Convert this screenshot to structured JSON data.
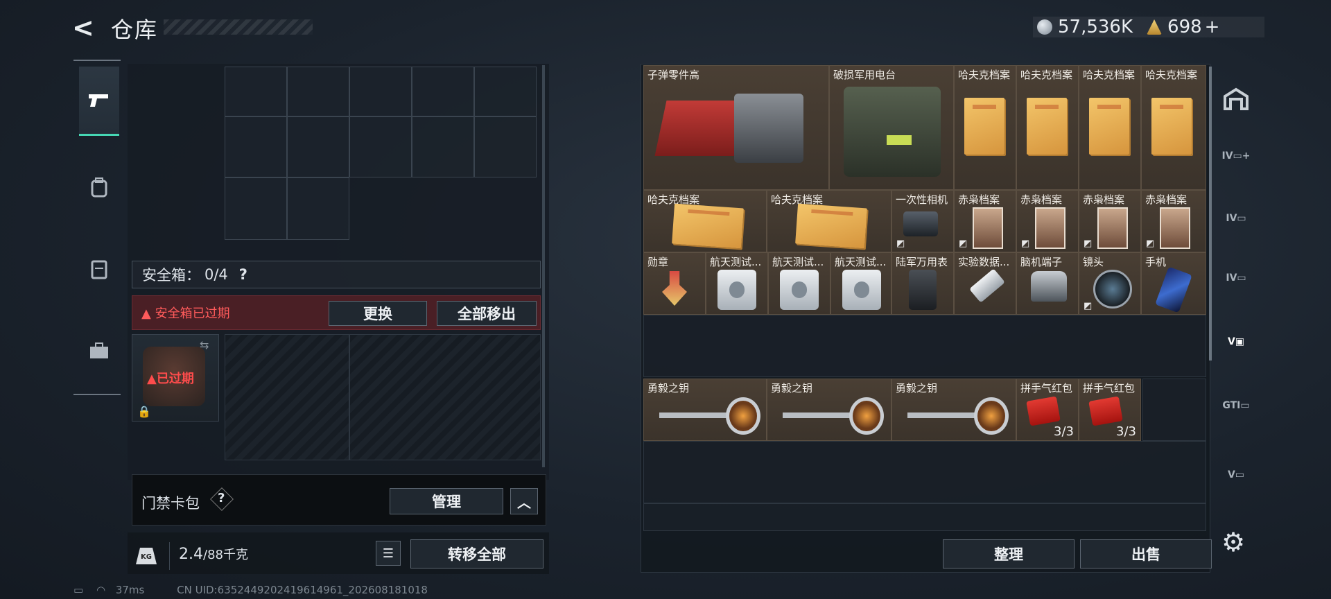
{
  "header": {
    "title": "仓库",
    "currency_silver": "57,536K",
    "currency_gold": "698",
    "add_symbol": "+"
  },
  "left_sidebar": {
    "items": [
      {
        "name": "weapon",
        "icon": "pistol-icon"
      },
      {
        "name": "backpack",
        "icon": "backpack-icon"
      },
      {
        "name": "vest",
        "icon": "vest-icon"
      },
      {
        "name": "case",
        "icon": "toolbox-icon"
      }
    ]
  },
  "safe_box": {
    "label": "安全箱：",
    "count": "0/4",
    "help": "?",
    "expired_notice": "安全箱已过期",
    "replace_button": "更换",
    "remove_all_button": "全部移出",
    "expired_tag": "已过期"
  },
  "keycard": {
    "label": "门禁卡包",
    "help": "?",
    "manage_button": "管理"
  },
  "weight": {
    "current": "2.4",
    "capacity": "/88千克",
    "transfer_all_button": "转移全部"
  },
  "inventory": {
    "items": [
      {
        "name": "子弹零件高"
      },
      {
        "name": "破损军用电台"
      },
      {
        "name": "哈夫克档案"
      },
      {
        "name": "哈夫克档案"
      },
      {
        "name": "哈夫克档案"
      },
      {
        "name": "哈夫克档案"
      },
      {
        "name": "哈夫克档案"
      },
      {
        "name": "哈夫克档案"
      },
      {
        "name": "一次性相机"
      },
      {
        "name": "赤枭档案"
      },
      {
        "name": "赤枭档案"
      },
      {
        "name": "赤枭档案"
      },
      {
        "name": "赤枭档案"
      },
      {
        "name": "勋章"
      },
      {
        "name": "航天测试..."
      },
      {
        "name": "航天测试..."
      },
      {
        "name": "航天测试..."
      },
      {
        "name": "陆军万用表"
      },
      {
        "name": "实验数据..."
      },
      {
        "name": "脑机端子"
      },
      {
        "name": "镜头"
      },
      {
        "name": "手机"
      },
      {
        "name": "勇毅之钥"
      },
      {
        "name": "勇毅之钥"
      },
      {
        "name": "勇毅之钥"
      },
      {
        "name": "拼手气红包",
        "count": "3/3"
      },
      {
        "name": "拼手气红包",
        "count": "3/3"
      }
    ],
    "sort_button": "整理",
    "sell_button": "出售"
  },
  "right_sidebar": {
    "tabs": [
      "IV",
      "IV",
      "IV",
      "V",
      "GTI",
      "V"
    ]
  },
  "footer": {
    "ping": "37ms",
    "uid": "CN UID:6352449202419614961_202608181018"
  },
  "colors": {
    "accent": "#46d7b4",
    "warning": "#ff5b5b",
    "item_bg": "#4a3f34"
  }
}
